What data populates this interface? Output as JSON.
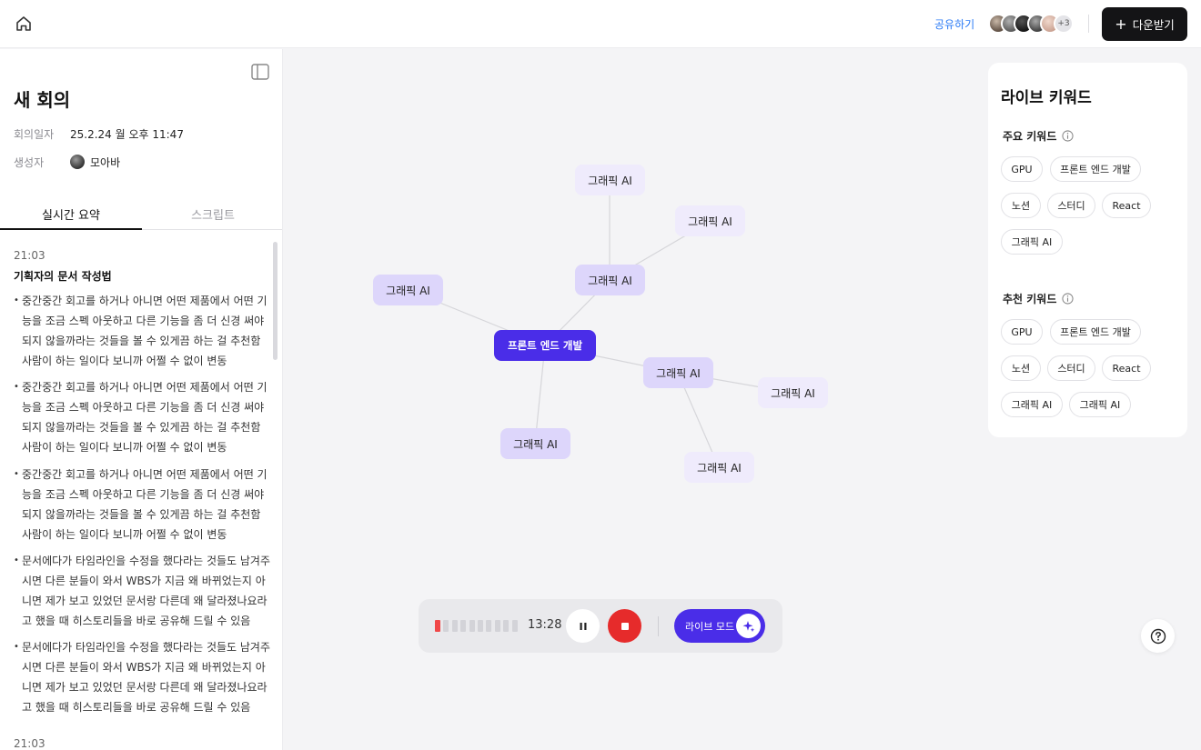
{
  "topbar": {
    "home_icon": "home-icon",
    "share_label": "공유하기",
    "avatar_more": "+3",
    "download_label": "다운받기"
  },
  "sidebar": {
    "toggle_icon": "sidebar-toggle-icon",
    "title": "새 회의",
    "date_label": "회의일자",
    "date_value": "25.2.24 월 오후 11:47",
    "creator_label": "생성자",
    "creator_name": "모아바",
    "tabs": [
      {
        "label": "실시간 요약",
        "active": true
      },
      {
        "label": "스크립트",
        "active": false
      }
    ],
    "summary": {
      "time": "21:03",
      "heading": "기획자의 문서 작성법",
      "bullets": [
        "중간중간 회고를 하거나 아니면 어떤 제품에서 어떤 기능을 조금 스펙 아웃하고 다른 기능을 좀 더 신경 써야 되지 않을까라는 것들을 볼 수 있게끔 하는 걸 추천함 사람이 하는 일이다 보니까 어쩔 수 없이 변동",
        "중간중간 회고를 하거나 아니면 어떤 제품에서 어떤 기능을 조금 스펙 아웃하고 다른 기능을 좀 더 신경 써야 되지 않을까라는 것들을 볼 수 있게끔 하는 걸 추천함 사람이 하는 일이다 보니까 어쩔 수 없이 변동",
        "중간중간 회고를 하거나 아니면 어떤 제품에서 어떤 기능을 조금 스펙 아웃하고 다른 기능을 좀 더 신경 써야 되지 않을까라는 것들을 볼 수 있게끔 하는 걸 추천함 사람이 하는 일이다 보니까 어쩔 수 없이 변동",
        "문서에다가 타임라인을 수정을 했다라는 것들도 남겨주시면 다른 분들이 와서 WBS가 지금 왜 바뀌었는지 아니면 제가 보고 있었던 문서랑 다른데 왜 달라졌나요라고 했을 때 히스토리들을 바로 공유해 드릴 수 있음",
        "문서에다가 타임라인을 수정을 했다라는 것들도 남겨주시면 다른 분들이 와서 WBS가 지금 왜 바뀌었는지 아니면 제가 보고 있었던 문서랑 다른데 왜 달라졌나요라고 했을 때 히스토리들을 바로 공유해 드릴 수 있음"
      ],
      "next_time": "21:03"
    }
  },
  "mindmap": {
    "center": "프론트 엔드 개발",
    "nodes": [
      "그래픽 AI",
      "그래픽 AI",
      "그래픽 AI",
      "그래픽 AI",
      "그래픽 AI",
      "그래픽 AI",
      "그래픽 AI",
      "그래픽 AI"
    ]
  },
  "keywords": {
    "title": "라이브 키워드",
    "main_label": "주요 키워드",
    "main": [
      "GPU",
      "프론트 엔드 개발",
      "노션",
      "스터디",
      "React",
      "그래픽 AI"
    ],
    "recommended_label": "추천 키워드",
    "recommended": [
      "GPU",
      "프론트 엔드 개발",
      "노션",
      "스터디",
      "React",
      "그래픽 AI",
      "그래픽 AI"
    ]
  },
  "recorder": {
    "elapsed": "13:28",
    "live_label": "라이브 모드",
    "level_fraction": 0.1
  },
  "colors": {
    "accent": "#4a2de8",
    "record_red": "#e62b2b",
    "share_blue": "#2b7bf5"
  }
}
